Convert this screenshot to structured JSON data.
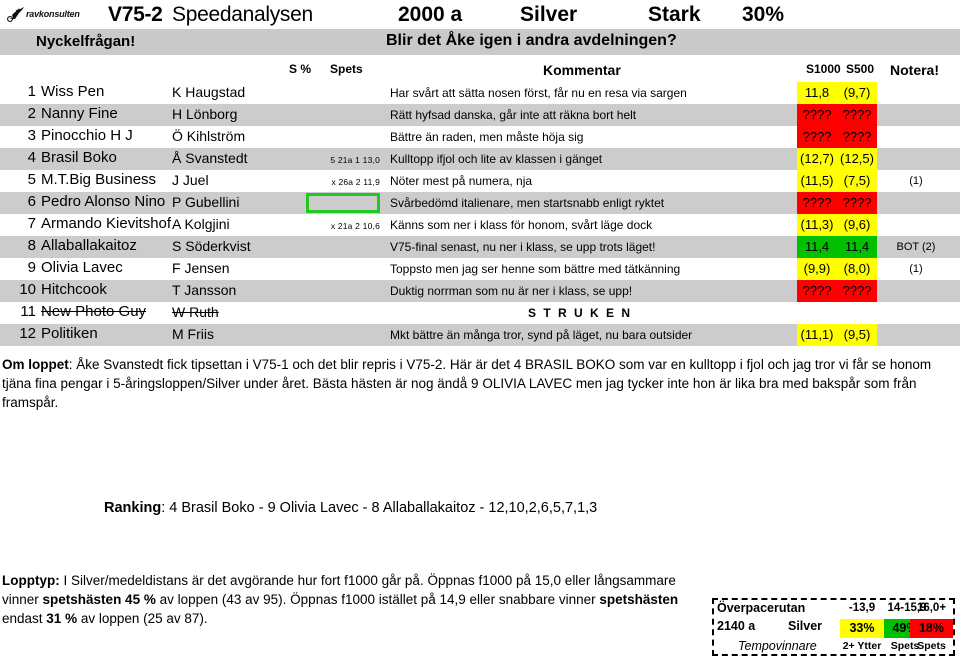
{
  "header": {
    "logo_text": "ravkonsulten",
    "race_code": "V75-2",
    "analysis_name": "Speedanalysen",
    "distance": "2000 a",
    "race_class": "Silver",
    "strength": "Stark",
    "percent": "30%",
    "key_label": "Nyckelfrågan!",
    "key_question": "Blir det Åke igen i andra avdelningen?"
  },
  "columns": {
    "s_pct": "S %",
    "spets": "Spets",
    "kommentar": "Kommentar",
    "s1000": "S1000",
    "s500": "S500",
    "notera": "Notera!"
  },
  "colors": {
    "yellow": "#FFFF00",
    "red": "#FF0000",
    "green": "#00C000",
    "band_gray": "#C9C9C9",
    "row_gray": "#CCCCCC",
    "box_green": "#22C722"
  },
  "rows": [
    {
      "num": "1",
      "horse": "Wiss Pen",
      "driver": "K Haugstad",
      "stat": "",
      "comment": "Har svårt att sätta nosen först, får nu en resa via sargen",
      "s1000": "11,8",
      "s500": "(9,7)",
      "s1000_bg": "#FFFF00",
      "s500_bg": "#FFFF00",
      "note": "",
      "striped": false,
      "scratched": false,
      "greenbox": false
    },
    {
      "num": "2",
      "horse": "Nanny Fine",
      "driver": "H Lönborg",
      "stat": "",
      "comment": "Rätt hyfsad danska, går inte att räkna bort helt",
      "s1000": "????",
      "s500": "????",
      "s1000_bg": "#FF0000",
      "s500_bg": "#FF0000",
      "note": "",
      "striped": true,
      "scratched": false,
      "greenbox": false
    },
    {
      "num": "3",
      "horse": "Pinocchio H J",
      "driver": "Ö Kihlström",
      "stat": "",
      "comment": "Bättre än raden, men måste höja sig",
      "s1000": "????",
      "s500": "????",
      "s1000_bg": "#FF0000",
      "s500_bg": "#FF0000",
      "note": "",
      "striped": false,
      "scratched": false,
      "greenbox": false
    },
    {
      "num": "4",
      "horse": "Brasil Boko",
      "driver": "Å Svanstedt",
      "stat": "5 21a 1 13,0",
      "comment": "Kulltopp ifjol och lite av klassen i gänget",
      "s1000": "(12,7)",
      "s500": "(12,5)",
      "s1000_bg": "#FFFF00",
      "s500_bg": "#FFFF00",
      "note": "",
      "striped": true,
      "scratched": false,
      "greenbox": false
    },
    {
      "num": "5",
      "horse": "M.T.Big Business",
      "driver": "J Juel",
      "stat": "x 26a 2 11,9",
      "comment": "Nöter mest på numera, nja",
      "s1000": "(11,5)",
      "s500": "(7,5)",
      "s1000_bg": "#FFFF00",
      "s500_bg": "#FFFF00",
      "note": "(1)",
      "striped": false,
      "scratched": false,
      "greenbox": false
    },
    {
      "num": "6",
      "horse": "Pedro Alonso Nino",
      "driver": "P Gubellini",
      "stat": "",
      "comment": "Svårbedömd italienare, men startsnabb enligt ryktet",
      "s1000": "????",
      "s500": "????",
      "s1000_bg": "#FF0000",
      "s500_bg": "#FF0000",
      "note": "",
      "striped": true,
      "scratched": false,
      "greenbox": true
    },
    {
      "num": "7",
      "horse": "Armando Kievitshof",
      "driver": "A Kolgjini",
      "stat": "x 21a 2 10,6",
      "comment": "Känns som ner i klass för honom, svårt läge dock",
      "s1000": "(11,3)",
      "s500": "(9,6)",
      "s1000_bg": "#FFFF00",
      "s500_bg": "#FFFF00",
      "note": "",
      "striped": false,
      "scratched": false,
      "greenbox": false
    },
    {
      "num": "8",
      "horse": "Allaballakaitoz",
      "driver": "S Söderkvist",
      "stat": "",
      "comment": "V75-final senast, nu ner i klass, se upp trots läget!",
      "s1000": "11,4",
      "s500": "11,4",
      "s1000_bg": "#00C000",
      "s500_bg": "#00C000",
      "note": "BOT (2)",
      "striped": true,
      "scratched": false,
      "greenbox": false
    },
    {
      "num": "9",
      "horse": "Olivia Lavec",
      "driver": "F Jensen",
      "stat": "",
      "comment": "Toppsto men jag ser henne som bättre med tätkänning",
      "s1000": "(9,9)",
      "s500": "(8,0)",
      "s1000_bg": "#FFFF00",
      "s500_bg": "#FFFF00",
      "note": "(1)",
      "striped": false,
      "scratched": false,
      "greenbox": false
    },
    {
      "num": "10",
      "horse": "Hitchcook",
      "driver": "T Jansson",
      "stat": "",
      "comment": "Duktig norrman som nu är ner i klass, se upp!",
      "s1000": "????",
      "s500": "????",
      "s1000_bg": "#FF0000",
      "s500_bg": "#FF0000",
      "note": "",
      "striped": true,
      "scratched": false,
      "greenbox": false
    },
    {
      "num": "11",
      "horse": "New Photo Guy",
      "driver": "W Ruth",
      "stat": "",
      "comment": "S T R U K E N",
      "s1000": "",
      "s500": "",
      "s1000_bg": "",
      "s500_bg": "",
      "note": "",
      "striped": false,
      "scratched": true,
      "greenbox": false,
      "comment_centered": true
    },
    {
      "num": "12",
      "horse": "Politiken",
      "driver": "M Friis",
      "stat": "",
      "comment": "Mkt bättre än många tror, synd på läget, nu bara outsider",
      "s1000": "(11,1)",
      "s500": "(9,5)",
      "s1000_bg": "#FFFF00",
      "s500_bg": "#FFFF00",
      "note": "",
      "striped": true,
      "scratched": false,
      "greenbox": false
    }
  ],
  "om_loppet": {
    "label": "Om loppet",
    "text": ": Åke Svanstedt fick tipsettan i V75-1 och det blir repris i V75-2. Här är det 4 BRASIL BOKO som var en kulltopp i fjol och jag tror vi får se honom tjäna fina pengar i 5-åringsloppen/Silver under året. Bästa hästen är nog ändå 9 OLIVIA LAVEC men jag tycker inte hon är lika bra med bakspår som från framspår."
  },
  "ranking": {
    "label": "Ranking",
    "text": ": 4 Brasil Boko - 9 Olivia Lavec - 8 Allaballakaitoz - 12,10,2,6,5,7,1,3"
  },
  "lopptyp": {
    "label": "Lopptyp:",
    "part1": " I Silver/medeldistans är det avgörande hur fort f1000 går på. Öppnas f1000 på 15,0 eller långsammare vinner ",
    "bold1": "spetshästen 45 %",
    "part2": " av loppen (43 av 95). Öppnas f1000 istället på 14,9 eller snabbare vinner ",
    "bold2": "spetshästen",
    "part3": " endast ",
    "bold3": "31 %",
    "part4": " av loppen (25 av 87)."
  },
  "infobox": {
    "title": "Överpacerutan",
    "distance": "2140 a",
    "class": "Silver",
    "tempo_label": "Tempovinnare",
    "head": [
      "-13,9",
      "14-15,9",
      "16,0+"
    ],
    "values": [
      "33%",
      "49%",
      "18%"
    ],
    "value_bgs": [
      "#FFFF00",
      "#00C000",
      "#FF0000"
    ],
    "footers": [
      "2+ Ytter",
      "Spets",
      "Spets"
    ]
  }
}
